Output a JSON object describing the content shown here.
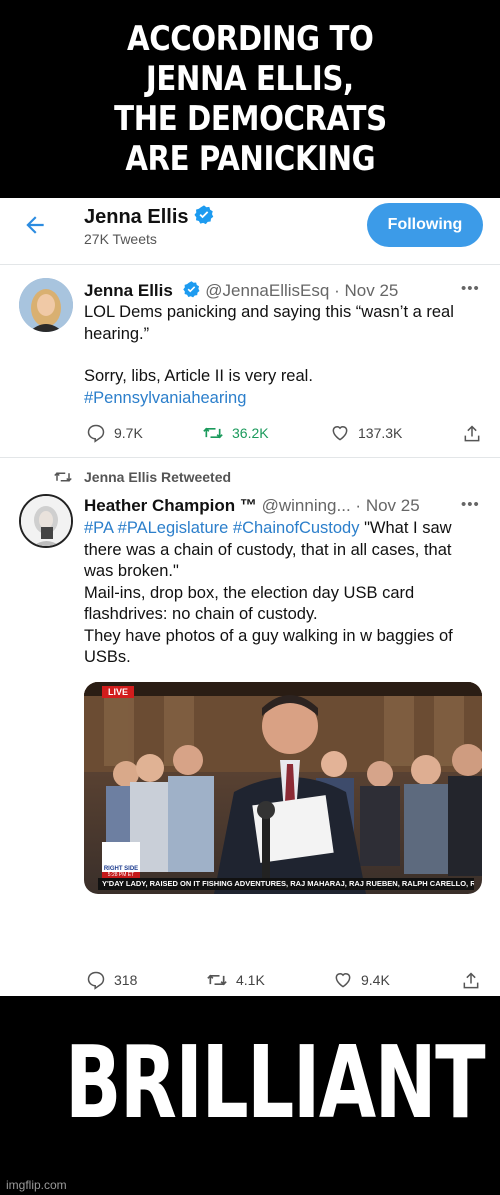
{
  "top_caption": [
    "ACCORDING TO",
    "JENNA ELLIS,",
    "THE DEMOCRATS",
    "ARE PANICKING"
  ],
  "header": {
    "name": "Jenna Ellis",
    "tweet_count": "27K Tweets",
    "follow_label": "Following"
  },
  "tweet1": {
    "name": "Jenna Ellis",
    "handle": "@JennaEllisEsq",
    "sep": "·",
    "date": "Nov 25",
    "line1": "LOL Dems panicking and saying this “wasn’t a real",
    "line2": "hearing.”",
    "line3": "Sorry, libs, Article II is very real.",
    "hashtag": "#Pennsylvaniahearing",
    "replies": "9.7K",
    "retweets": "36.2K",
    "likes": "137.3K"
  },
  "retweet_label": "Jenna Ellis Retweeted",
  "tweet2": {
    "name": "Heather Champion ™",
    "handle": "@winning...",
    "sep": "·",
    "date": "Nov 25",
    "tags": "#PA #PALegislature #ChainofCustody",
    "line1_rest": " \"What I saw",
    "line2": "there was a chain of custody, that in all cases, that",
    "line3": "was broken.\"",
    "line4": "Mail-ins, drop box, the election day USB card",
    "line5": "flashdrives: no chain of custody.",
    "line6": "They have photos of a guy walking in w baggies of",
    "line7": "USBs.",
    "media": {
      "live_badge": "LIVE",
      "ticker": "Y'DAY LADY, RAISED ON IT FISHING ADVENTURES, RAJ MAHARAJ, RAJ RUEBEN, RALPH CARELLO, RALPH LOMBARDI, RA",
      "station_label": "RIGHT SIDE",
      "station_time": "5:28 PM ET"
    },
    "replies": "318",
    "retweets": "4.1K",
    "likes": "9.4K"
  },
  "bottom_caption": "BRILLIANT",
  "watermark": "imgflip.com",
  "colors": {
    "accent": "#3c9be8",
    "link": "#2c7fcb",
    "retweet_green": "#1b9a5c",
    "verified": "#1d9bf0"
  }
}
